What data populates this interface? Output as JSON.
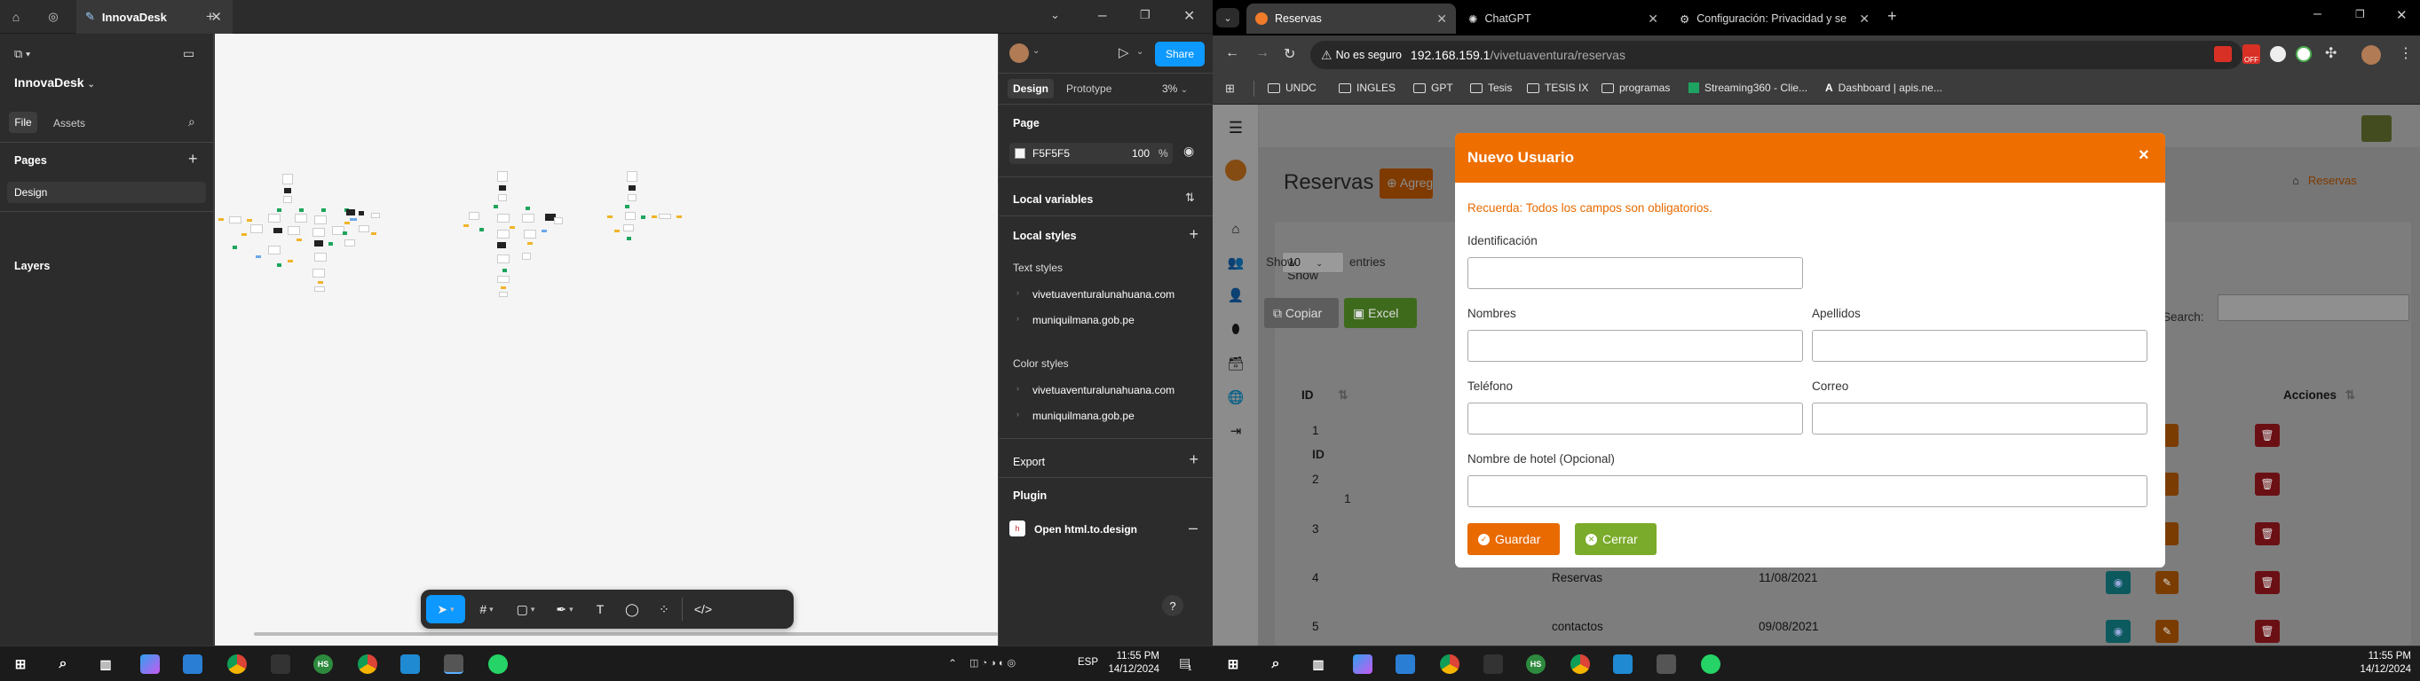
{
  "figma": {
    "tab_title": "InnovaDesk",
    "file_name": "InnovaDesk",
    "left_tabs": [
      "File",
      "Assets"
    ],
    "pages_label": "Pages",
    "page_item": "Design",
    "layers_label": "Layers",
    "right_tabs": [
      "Design",
      "Prototype"
    ],
    "zoom": "3%",
    "share_label": "Share",
    "page_section": "Page",
    "page_color": "F5F5F5",
    "page_opacity": "100",
    "percent_sign": "%",
    "local_variables": "Local variables",
    "local_styles": "Local styles",
    "text_styles_label": "Text styles",
    "text_styles": [
      "vivetuaventuralunahuana.com",
      "muniquilmana.gob.pe"
    ],
    "color_styles_label": "Color styles",
    "color_styles": [
      "vivetuaventuralunahuana.com",
      "muniquilmana.gob.pe"
    ],
    "export_label": "Export",
    "plugin_label": "Plugin",
    "plugin_item": "Open html.to.design",
    "help": "?"
  },
  "chrome": {
    "tabs": [
      {
        "title": "Reservas",
        "active": true
      },
      {
        "title": "ChatGPT",
        "active": false
      },
      {
        "title": "Configuración: Privacidad y se",
        "active": false
      }
    ],
    "security_label": "No es seguro",
    "url_host": "192.168.159.1",
    "url_path": "/vivetuaventura/reservas",
    "bookmarks": [
      "UNDC",
      "INGLES",
      "GPT",
      "Tesis",
      "TESIS IX",
      "programas",
      "Streaming360 - Clie...",
      "Dashboard | apis.ne..."
    ]
  },
  "webapp": {
    "page_title": "Reservas",
    "add_button": "Agregar",
    "breadcrumb_current": "Reservas",
    "show_label": "Show",
    "entries_value": "10",
    "entries_label": "entries",
    "copy_button": "Copiar",
    "excel_button": "Excel",
    "search_label": "Search:",
    "columns": [
      "ID",
      "Acciones"
    ],
    "rows": [
      {
        "id": "1",
        "name": "",
        "date": ""
      },
      {
        "id": "2",
        "name": "",
        "date": ""
      },
      {
        "id": "3",
        "name": "",
        "date": ""
      },
      {
        "id": "4",
        "name": "Reservas",
        "date": "11/08/2021"
      },
      {
        "id": "5",
        "name": "contactos",
        "date": "09/08/2021"
      }
    ]
  },
  "modal": {
    "title": "Nuevo Usuario",
    "close": "×",
    "notice": "Recuerda: Todos los campos son obligatorios.",
    "fields": {
      "identificacion": "Identificación",
      "nombres": "Nombres",
      "apellidos": "Apellidos",
      "telefono": "Teléfono",
      "correo": "Correo",
      "hotel": "Nombre de hotel (Opcional)"
    },
    "save_button": "Guardar",
    "close_button": "Cerrar"
  },
  "taskbar": {
    "lang": "ESP",
    "time": "11:55 PM",
    "time_right": "11:55 PM",
    "date": "14/12/2024",
    "notif_count": "1"
  },
  "colors": {
    "figma_blue": "#0d99ff",
    "modal_orange": "#ee6f00",
    "save_orange": "#e86a00",
    "close_green": "#7aab2a",
    "canvas_bg": "#f5f5f5"
  }
}
